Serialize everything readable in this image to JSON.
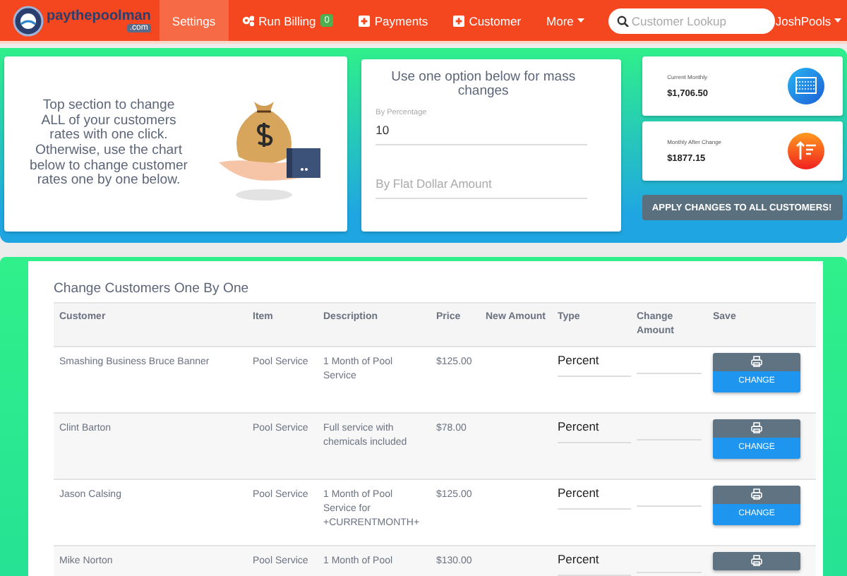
{
  "navbar": {
    "logo": {
      "name": "paythepoolman",
      "suffix": ".com"
    },
    "items": [
      {
        "label": "Settings",
        "kind": "plain",
        "selected": true
      },
      {
        "label": "Run Billing",
        "kind": "billing",
        "badge": "0",
        "selected": false
      },
      {
        "label": "Payments",
        "kind": "add",
        "selected": false
      },
      {
        "label": "Customer",
        "kind": "add",
        "selected": false
      },
      {
        "label": "More",
        "kind": "menu",
        "selected": false
      }
    ],
    "search": {
      "placeholder": "Customer Lookup"
    },
    "user": "JoshPools"
  },
  "mass_change": {
    "intro": "Top section to change ALL of your customers rates with one click. Otherwise, use the chart below to change customer rates one by one below.",
    "heading": "Use one option below for mass changes",
    "fields": [
      {
        "label": "By Percentage",
        "value": "10"
      },
      {
        "placeholder": "By Flat Dollar Amount"
      }
    ],
    "stats": [
      {
        "label": "Current Monthly",
        "value": "$1,706.50",
        "kind": "current"
      },
      {
        "label": "Monthly After Change",
        "value": "$1877.15",
        "kind": "after"
      }
    ],
    "apply_button": "APPLY CHANGES TO ALL CUSTOMERS!"
  },
  "table": {
    "title": "Change Customers One By One",
    "columns": [
      "Customer",
      "Item",
      "Description",
      "Price",
      "New Amount",
      "Type",
      "Change Amount",
      "Save"
    ],
    "rows": [
      {
        "customer": "Smashing Business Bruce Banner",
        "item": "Pool Service",
        "description": "1 Month of Pool Service",
        "price": "$125.00",
        "type": "Percent",
        "save_label": "CHANGE"
      },
      {
        "customer": "Clint Barton",
        "item": "Pool Service",
        "description": "Full service with chemicals included",
        "price": "$78.00",
        "type": "Percent",
        "save_label": "CHANGE"
      },
      {
        "customer": "Jason Calsing",
        "item": "Pool Service",
        "description": "1 Month of Pool Service for +CURRENTMONTH+",
        "price": "$125.00",
        "type": "Percent",
        "save_label": "CHANGE"
      },
      {
        "customer": "Mike Norton",
        "item": "Pool Service",
        "description": "1 Month of Pool",
        "price": "$130.00",
        "type": "Percent"
      }
    ]
  }
}
